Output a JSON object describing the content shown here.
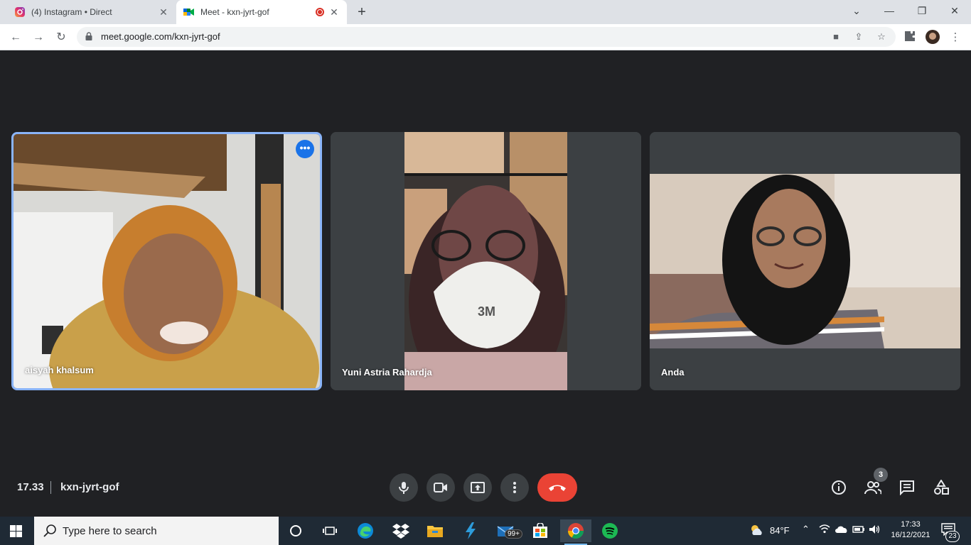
{
  "browser": {
    "tabs": [
      {
        "title": "(4) Instagram • Direct"
      },
      {
        "title": "Meet - kxn-jyrt-gof"
      }
    ],
    "url": "meet.google.com/kxn-jyrt-gof"
  },
  "meet": {
    "participants": [
      {
        "name": "aisyah khalsum"
      },
      {
        "name": "Yuni Astria Rahardja"
      },
      {
        "name": "Anda"
      }
    ],
    "time": "17.33",
    "meeting_code": "kxn-jyrt-gof",
    "participant_count": "3"
  },
  "taskbar": {
    "search_placeholder": "Type here to search",
    "weather": "84°F",
    "mail_badge": "99+",
    "clock_time": "17:33",
    "clock_date": "16/12/2021",
    "notification_count": "23"
  },
  "colors": {
    "accent": "#8ab4f8",
    "end_call": "#ea4335",
    "stage_bg": "#202124",
    "tile_bg": "#3c4043"
  }
}
